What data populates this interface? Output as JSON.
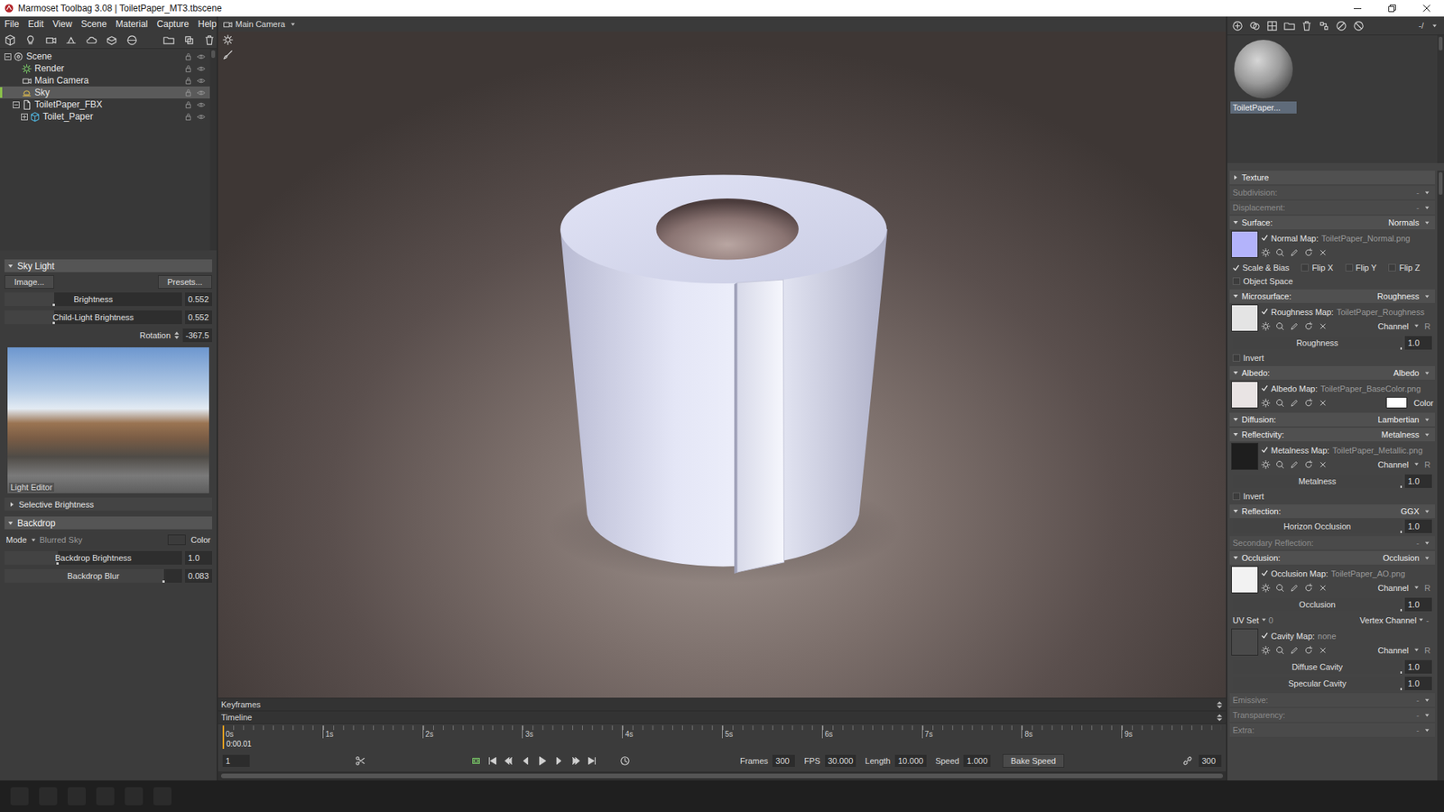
{
  "window": {
    "title": "Marmoset Toolbag 3.08 | ToiletPaper_MT3.tbscene"
  },
  "menu": [
    "File",
    "Edit",
    "View",
    "Scene",
    "Material",
    "Capture",
    "Help"
  ],
  "viewport": {
    "camera": "Main Camera"
  },
  "scene_tree": [
    {
      "label": "Scene",
      "kind": "scene",
      "expanded": true,
      "selected": false,
      "locked": false,
      "visible": true,
      "children": [
        {
          "label": "Render",
          "kind": "render",
          "selected": false,
          "locked": false,
          "visible": true
        },
        {
          "label": "Main Camera",
          "kind": "camera",
          "selected": false,
          "locked": false,
          "visible": true
        },
        {
          "label": "Sky",
          "kind": "sky",
          "selected": true,
          "locked": false,
          "visible": true
        },
        {
          "label": "ToiletPaper_FBX",
          "kind": "file",
          "expanded": true,
          "selected": false,
          "locked": false,
          "visible": true,
          "children": [
            {
              "label": "Toilet_Paper",
              "kind": "mesh",
              "expanded": false,
              "selected": false,
              "locked": false,
              "visible": true,
              "children": []
            }
          ]
        }
      ]
    }
  ],
  "sky_light": {
    "title": "Sky Light",
    "expanded": true,
    "buttons": [
      "Image...",
      "Presets..."
    ],
    "sliders": [
      {
        "label": "Brightness",
        "value": "0.552",
        "level": 0.28
      },
      {
        "label": "Child-Light Brightness",
        "value": "0.552",
        "level": 0.28
      }
    ],
    "rotation": {
      "label": "Rotation",
      "value": "-367.5"
    },
    "image_caption": "Light Editor",
    "subsection": {
      "title": "Selective Brightness",
      "expanded": false
    }
  },
  "backdrop": {
    "title": "Backdrop",
    "expanded": true,
    "mode_label": "Mode",
    "mode_value": "Blurred Sky",
    "color_label": "Color",
    "color": "#3b3b3b",
    "sliders": [
      {
        "label": "Backdrop Brightness",
        "value": "1.0",
        "level": 0.3
      },
      {
        "label": "Backdrop Blur",
        "value": "0.083",
        "level": 0.9
      }
    ]
  },
  "timeline": {
    "keyframes_label": "Keyframes",
    "timeline_label": "Timeline",
    "ticks": [
      "0s",
      "1s",
      "2s",
      "3s",
      "4s",
      "5s",
      "6s",
      "7s",
      "8s",
      "9s"
    ],
    "current_time": "0:00.01",
    "playhead": 0,
    "frame": "1",
    "fields": [
      {
        "label": "Frames",
        "value": "300"
      },
      {
        "label": "FPS",
        "value": "30.000"
      },
      {
        "label": "Length",
        "value": "10.000"
      },
      {
        "label": "Speed",
        "value": "1.000"
      }
    ],
    "bake_button": "Bake Speed",
    "end_frame": "300",
    "loop": true
  },
  "material_list": {
    "counter": "-/",
    "items": [
      {
        "label": "ToiletPaper...",
        "selected": true
      }
    ]
  },
  "properties": [
    {
      "label": "Texture",
      "expanded": false,
      "disabled": false,
      "rows": []
    },
    {
      "label": "Subdivision:",
      "value": "-",
      "expanded": false,
      "disabled": true,
      "rows": []
    },
    {
      "label": "Displacement:",
      "value": "-",
      "expanded": false,
      "disabled": true,
      "rows": []
    },
    {
      "label": "Surface:",
      "value": "Normals",
      "expanded": true,
      "disabled": false,
      "rows": [
        {
          "kind": "map",
          "label": "Normal Map:",
          "file": "ToiletPaper_Normal.png",
          "checked": true,
          "color": "#b3b3fb"
        },
        {
          "kind": "checks",
          "items": [
            {
              "label": "Scale & Bias",
              "checked": true
            },
            {
              "label": "Flip X",
              "checked": false
            },
            {
              "label": "Flip Y",
              "checked": false
            },
            {
              "label": "Flip Z",
              "checked": false
            }
          ]
        },
        {
          "kind": "checks",
          "items": [
            {
              "label": "Object Space",
              "checked": false
            }
          ]
        }
      ]
    },
    {
      "label": "Microsurface:",
      "value": "Roughness",
      "expanded": true,
      "disabled": false,
      "rows": [
        {
          "kind": "map",
          "label": "Roughness Map:",
          "file": "ToiletPaper_Roughness",
          "checked": true,
          "color": "#e4e4e4",
          "channel": {
            "label": "Channel",
            "value": "R"
          }
        },
        {
          "kind": "slider",
          "label": "Roughness",
          "value": "1.0",
          "level": 1
        },
        {
          "kind": "checks",
          "items": [
            {
              "label": "Invert",
              "checked": false
            }
          ]
        }
      ]
    },
    {
      "label": "Albedo:",
      "value": "Albedo",
      "expanded": true,
      "disabled": false,
      "rows": [
        {
          "kind": "map",
          "label": "Albedo Map:",
          "file": "ToiletPaper_BaseColor.png",
          "checked": true,
          "color": "#e9e4e4",
          "swatch": {
            "label": "Color",
            "color": "#ffffff"
          }
        }
      ]
    },
    {
      "label": "Diffusion:",
      "value": "Lambertian",
      "expanded": true,
      "disabled": false,
      "rows": []
    },
    {
      "label": "Reflectivity:",
      "value": "Metalness",
      "expanded": true,
      "disabled": false,
      "rows": [
        {
          "kind": "map",
          "label": "Metalness Map:",
          "file": "ToiletPaper_Metallic.png",
          "checked": true,
          "color": "#1e1e1e",
          "channel": {
            "label": "Channel",
            "value": "R"
          }
        },
        {
          "kind": "slider",
          "label": "Metalness",
          "value": "1.0",
          "level": 1
        },
        {
          "kind": "checks",
          "items": [
            {
              "label": "Invert",
              "checked": false
            }
          ]
        }
      ]
    },
    {
      "label": "Reflection:",
      "value": "GGX",
      "expanded": true,
      "disabled": false,
      "rows": [
        {
          "kind": "slider",
          "label": "Horizon Occlusion",
          "value": "1.0",
          "level": 1
        }
      ]
    },
    {
      "label": "Secondary Reflection:",
      "value": "-",
      "expanded": false,
      "disabled": true,
      "rows": []
    },
    {
      "label": "Occlusion:",
      "value": "Occlusion",
      "expanded": true,
      "disabled": false,
      "rows": [
        {
          "kind": "map",
          "label": "Occlusion Map:",
          "file": "ToiletPaper_AO.png",
          "checked": true,
          "color": "#f2f2f2",
          "channel": {
            "label": "Channel",
            "value": "R"
          }
        },
        {
          "kind": "slider",
          "label": "Occlusion",
          "value": "1.0",
          "level": 1
        },
        {
          "kind": "dropdowns",
          "items": [
            {
              "label": "UV Set",
              "value": "0"
            },
            {
              "label": "Vertex Channel",
              "value": "-"
            }
          ]
        },
        {
          "kind": "map",
          "label": "Cavity Map:",
          "file": "none",
          "checked": true,
          "color": "#4a4a4a",
          "channel": {
            "label": "Channel",
            "value": "R"
          }
        },
        {
          "kind": "slider",
          "label": "Diffuse Cavity",
          "value": "1.0",
          "level": 1
        },
        {
          "kind": "slider",
          "label": "Specular Cavity",
          "value": "1.0",
          "level": 1
        }
      ]
    },
    {
      "label": "Emissive:",
      "value": "-",
      "expanded": false,
      "disabled": true,
      "rows": []
    },
    {
      "label": "Transparency:",
      "value": "-",
      "expanded": false,
      "disabled": true,
      "rows": []
    },
    {
      "label": "Extra:",
      "value": "-",
      "expanded": false,
      "disabled": true,
      "rows": []
    }
  ]
}
